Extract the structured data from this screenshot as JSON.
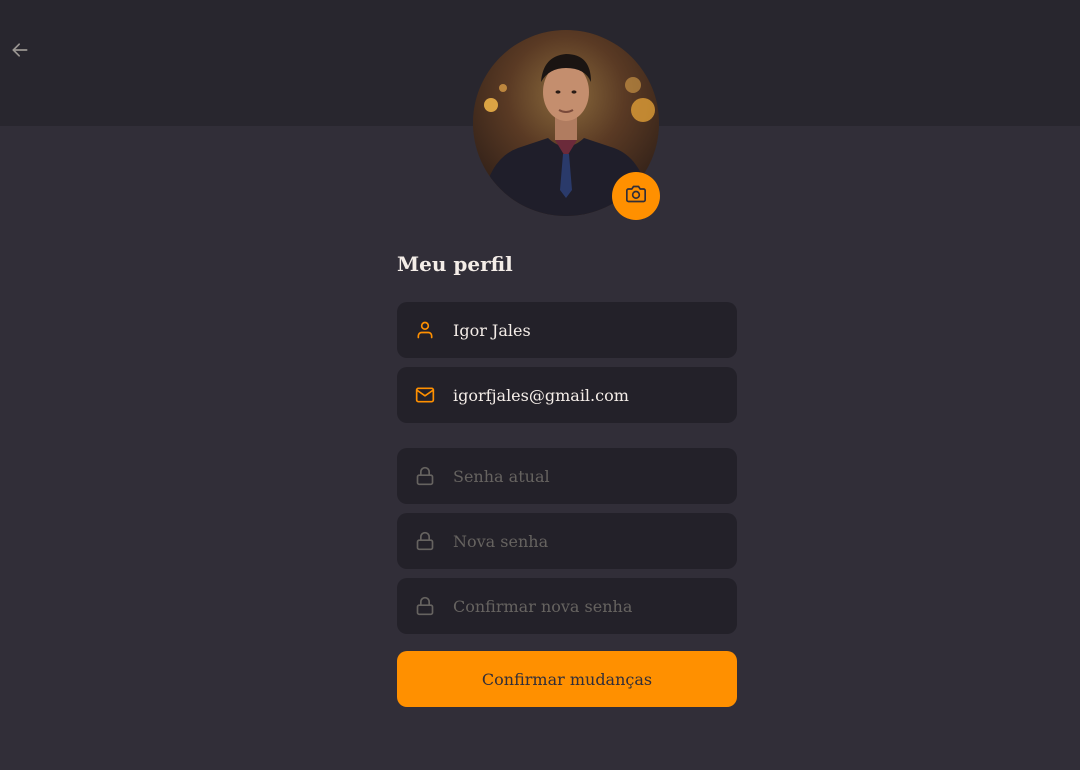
{
  "theme": {
    "background": "#312e38",
    "header_background": "#28262e",
    "input_background": "#232129",
    "accent": "#ff9000",
    "text": "#f4ede8",
    "placeholder": "#666360"
  },
  "header": {
    "back_icon": "arrow-left-icon"
  },
  "profile": {
    "avatar_alt": "Igor Jales",
    "camera_icon": "camera-icon",
    "title": "Meu perfil"
  },
  "form": {
    "name": {
      "value": "Igor Jales",
      "icon": "user-icon"
    },
    "email": {
      "value": "igorfjales@gmail.com",
      "icon": "mail-icon"
    },
    "old_password": {
      "placeholder": "Senha atual",
      "icon": "lock-icon"
    },
    "new_password": {
      "placeholder": "Nova senha",
      "icon": "lock-icon"
    },
    "confirm_password": {
      "placeholder": "Confirmar nova senha",
      "icon": "lock-icon"
    },
    "submit_label": "Confirmar mudanças"
  }
}
